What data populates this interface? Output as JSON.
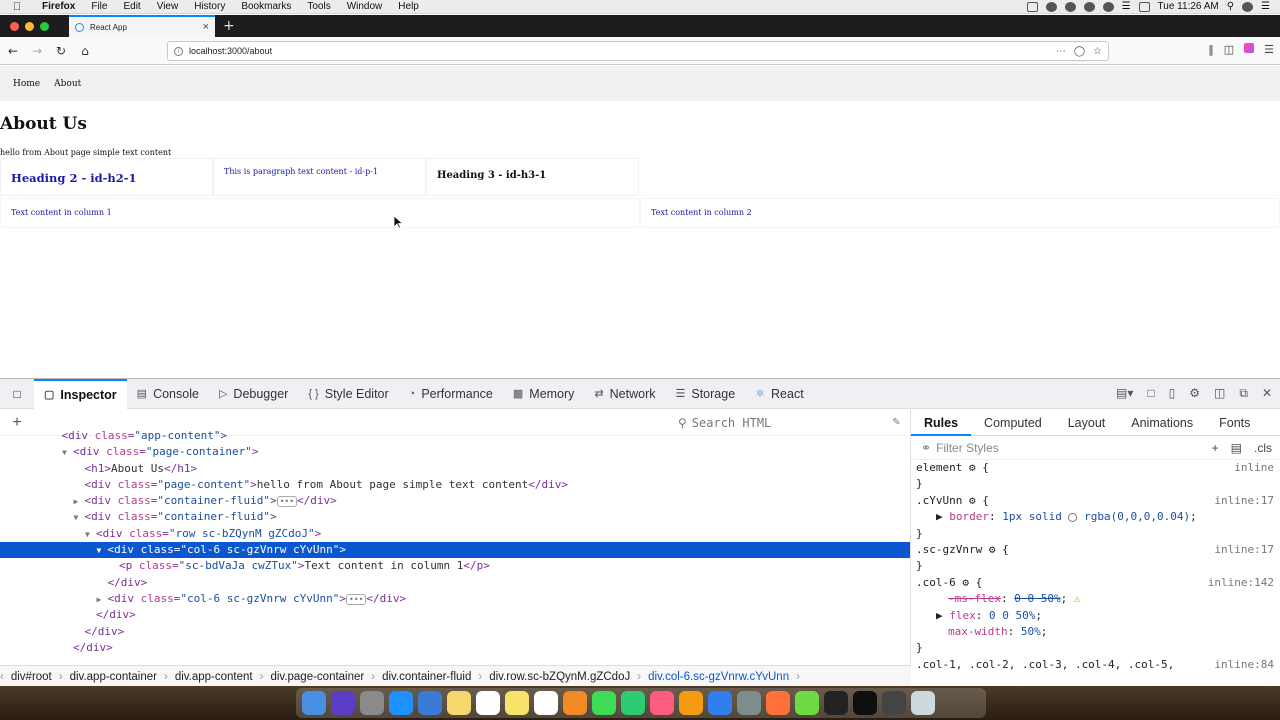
{
  "menubar": {
    "apple_icon": "apple-icon",
    "items": [
      "Firefox",
      "File",
      "Edit",
      "View",
      "History",
      "Bookmarks",
      "Tools",
      "Window",
      "Help"
    ],
    "clock": "Tue 11:26 AM"
  },
  "browser": {
    "tab_title": "React App",
    "url": "localhost:3000/about"
  },
  "page": {
    "nav": [
      "Home",
      "About"
    ],
    "h1": "About Us",
    "page_content": "hello from About page simple text content",
    "h2": "Heading 2 - id-h2-1",
    "paragraph": "This is paragraph text content - id-p-1",
    "h3": "Heading 3 - id-h3-1",
    "col1_text": "Text content in column 1",
    "col2_text": "Text content in column 2"
  },
  "devtools": {
    "tabs": [
      "Inspector",
      "Console",
      "Debugger",
      "Style Editor",
      "Performance",
      "Memory",
      "Network",
      "Storage",
      "React"
    ],
    "search_placeholder": "Search HTML",
    "markup_lines": [
      {
        "indent": 0,
        "tw": "",
        "open": "div",
        "attrs": [
          [
            "class",
            "app-content"
          ]
        ],
        "close": "",
        "text": "",
        "cut": true
      },
      {
        "indent": 1,
        "tw": "▼",
        "open": "div",
        "attrs": [
          [
            "class",
            "page-container"
          ]
        ],
        "text": "",
        "close": ""
      },
      {
        "indent": 2,
        "tw": "",
        "open": "h1",
        "attrs": [],
        "text": "About Us",
        "close": "h1"
      },
      {
        "indent": 2,
        "tw": "",
        "open": "div",
        "attrs": [
          [
            "class",
            "page-content"
          ]
        ],
        "text": "hello from About page simple text content",
        "close": "div"
      },
      {
        "indent": 2,
        "tw": "▶",
        "open": "div",
        "attrs": [
          [
            "class",
            "container-fluid"
          ]
        ],
        "text": "",
        "ellipsis": true,
        "close": "div"
      },
      {
        "indent": 2,
        "tw": "▼",
        "open": "div",
        "attrs": [
          [
            "class",
            "container-fluid"
          ]
        ],
        "text": "",
        "close": ""
      },
      {
        "indent": 3,
        "tw": "▼",
        "open": "div",
        "attrs": [
          [
            "class",
            "row sc-bZQynM gZCdoJ"
          ]
        ],
        "text": "",
        "close": ""
      },
      {
        "indent": 4,
        "tw": "▼",
        "open": "div",
        "attrs": [
          [
            "class",
            "col-6 sc-gzVnrw cYvUnn"
          ]
        ],
        "text": "",
        "close": "",
        "selected": true
      },
      {
        "indent": 5,
        "tw": "",
        "open": "p",
        "attrs": [
          [
            "class",
            "sc-bdVaJa cwZTux"
          ]
        ],
        "text": "Text content in column 1",
        "close": "p"
      },
      {
        "indent": 4,
        "tw": "",
        "open": "",
        "attrs": [],
        "text": "",
        "close": "div"
      },
      {
        "indent": 4,
        "tw": "▶",
        "open": "div",
        "attrs": [
          [
            "class",
            "col-6 sc-gzVnrw cYvUnn"
          ]
        ],
        "text": "",
        "ellipsis": true,
        "close": "div"
      },
      {
        "indent": 3,
        "tw": "",
        "open": "",
        "attrs": [],
        "text": "",
        "close": "div"
      },
      {
        "indent": 2,
        "tw": "",
        "open": "",
        "attrs": [],
        "text": "",
        "close": "div"
      },
      {
        "indent": 1,
        "tw": "",
        "open": "",
        "attrs": [],
        "text": "",
        "close": "div"
      }
    ],
    "breadcrumbs": [
      "div#root",
      "div.app-container",
      "div.app-content",
      "div.page-container",
      "div.container-fluid",
      "div.row.sc-bZQynM.gZCdoJ",
      "div.col-6.sc-gzVnrw.cYvUnn"
    ],
    "side_tabs": [
      "Rules",
      "Computed",
      "Layout",
      "Animations",
      "Fonts"
    ],
    "filter_placeholder": "Filter Styles",
    "cls_label": ".cls",
    "rules": [
      {
        "selector": "element",
        "source": "inline",
        "decls": []
      },
      {
        "selector": ".cYvUnn",
        "source": "inline:17",
        "decls": [
          {
            "prop": "border",
            "value": "1px solid",
            "color": "rgba(0,0,0,0.04)",
            "expand": true
          }
        ]
      },
      {
        "selector": ".sc-gzVnrw",
        "source": "inline:17",
        "decls": []
      },
      {
        "selector": ".col-6",
        "source": "inline:142",
        "decls": [
          {
            "prop": "-ms-flex",
            "value": "0 0 50%",
            "struck": true,
            "warn": true
          },
          {
            "prop": "flex",
            "value": "0 0 50%",
            "expand": true
          },
          {
            "prop": "max-width",
            "value": "50%"
          }
        ]
      },
      {
        "selector": ".col-1, .col-2, .col-3, .col-4, .col-5,",
        "source": "inline:84",
        "decls": [],
        "cut": true
      }
    ]
  },
  "colors": {
    "accent": "#0a84ff",
    "selection": "#0b57d0",
    "link_blue": "#1a1aa8"
  },
  "dock": {
    "icons": [
      "finder-icon",
      "siri-icon",
      "launchpad-icon",
      "safari-icon",
      "preview-icon",
      "notes-icon",
      "calendar-icon",
      "stickies-icon",
      "reminders-icon",
      "photos-icon",
      "messages-icon",
      "facetime-icon",
      "itunes-icon",
      "books-icon",
      "appstore-icon",
      "preferences-icon",
      "firefox-icon",
      "upwork-icon",
      "terminal-icon",
      "webstorm-icon",
      "filebox-icon",
      "trash-icon"
    ],
    "colors": [
      "#4a90e2",
      "#5b3cc4",
      "#8a8a8a",
      "#1e90ff",
      "#3a7bd5",
      "#f5d76e",
      "#ffffff",
      "#f7e36b",
      "#ffffff",
      "#f08a24",
      "#3ddc56",
      "#2ecc71",
      "#fc5c7d",
      "#f39c12",
      "#2f80ed",
      "#7f8c8d",
      "#ff7139",
      "#6fda44",
      "#222222",
      "#0f0f0f",
      "#444444",
      "#cfd8dc"
    ]
  }
}
